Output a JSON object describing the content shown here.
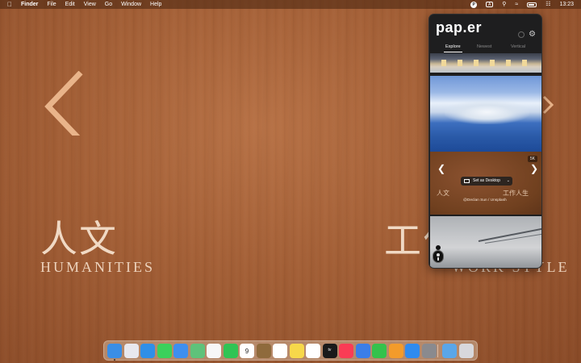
{
  "menubar": {
    "apple_icon": "apple-icon",
    "app_name": "Finder",
    "menus": [
      "File",
      "Edit",
      "View",
      "Go",
      "Window",
      "Help"
    ],
    "status": {
      "clock": "13:23",
      "input_indicator": "A",
      "paper_badge": "P"
    }
  },
  "wallpaper": {
    "left_cjk": "人文",
    "left_latin": "HUMANITIES",
    "right_cjk": "工作人生",
    "right_latin": "WORK STYLE"
  },
  "panel": {
    "logo": "pap.er",
    "tabs": [
      "Explore",
      "Newest",
      "Vertical"
    ],
    "active_tab": "Explore",
    "resolution_badge": "5K",
    "set_desktop_label": "Set as Desktop",
    "credit": "@Declan Sun / Unsplash",
    "preview_left_cjk": "人文",
    "preview_right_cjk": "工作人生"
  },
  "dock": {
    "apps": [
      {
        "name": "Finder",
        "color": "#3a8ee6"
      },
      {
        "name": "Launchpad",
        "color": "#e8e8ee"
      },
      {
        "name": "Safari",
        "color": "#2f8fe8"
      },
      {
        "name": "Messages",
        "color": "#3bd15b"
      },
      {
        "name": "Mail",
        "color": "#3e8ff0"
      },
      {
        "name": "Maps",
        "color": "#5fc27a"
      },
      {
        "name": "Photos",
        "color": "#f7f7f7"
      },
      {
        "name": "FaceTime",
        "color": "#2fc454"
      },
      {
        "name": "Calendar",
        "color": "#ffffff"
      },
      {
        "name": "Notes-brown",
        "color": "#8f6a3c"
      },
      {
        "name": "Reminders",
        "color": "#ffffff"
      },
      {
        "name": "Notes",
        "color": "#f7d84a"
      },
      {
        "name": "Freeform",
        "color": "#ffffff"
      },
      {
        "name": "TV",
        "color": "#1a1a1a"
      },
      {
        "name": "Music",
        "color": "#fa3c55"
      },
      {
        "name": "Keynote",
        "color": "#3a7ee8"
      },
      {
        "name": "Numbers",
        "color": "#34c24c"
      },
      {
        "name": "Pages",
        "color": "#f39b2b"
      },
      {
        "name": "App Store",
        "color": "#2f8bef"
      },
      {
        "name": "System Settings",
        "color": "#8a8a8e"
      },
      {
        "name": "Downloads",
        "color": "#5aa6e8"
      },
      {
        "name": "Trash",
        "color": "#d8d8dc"
      }
    ],
    "calendar_day": "9",
    "tv_label": "tv"
  }
}
